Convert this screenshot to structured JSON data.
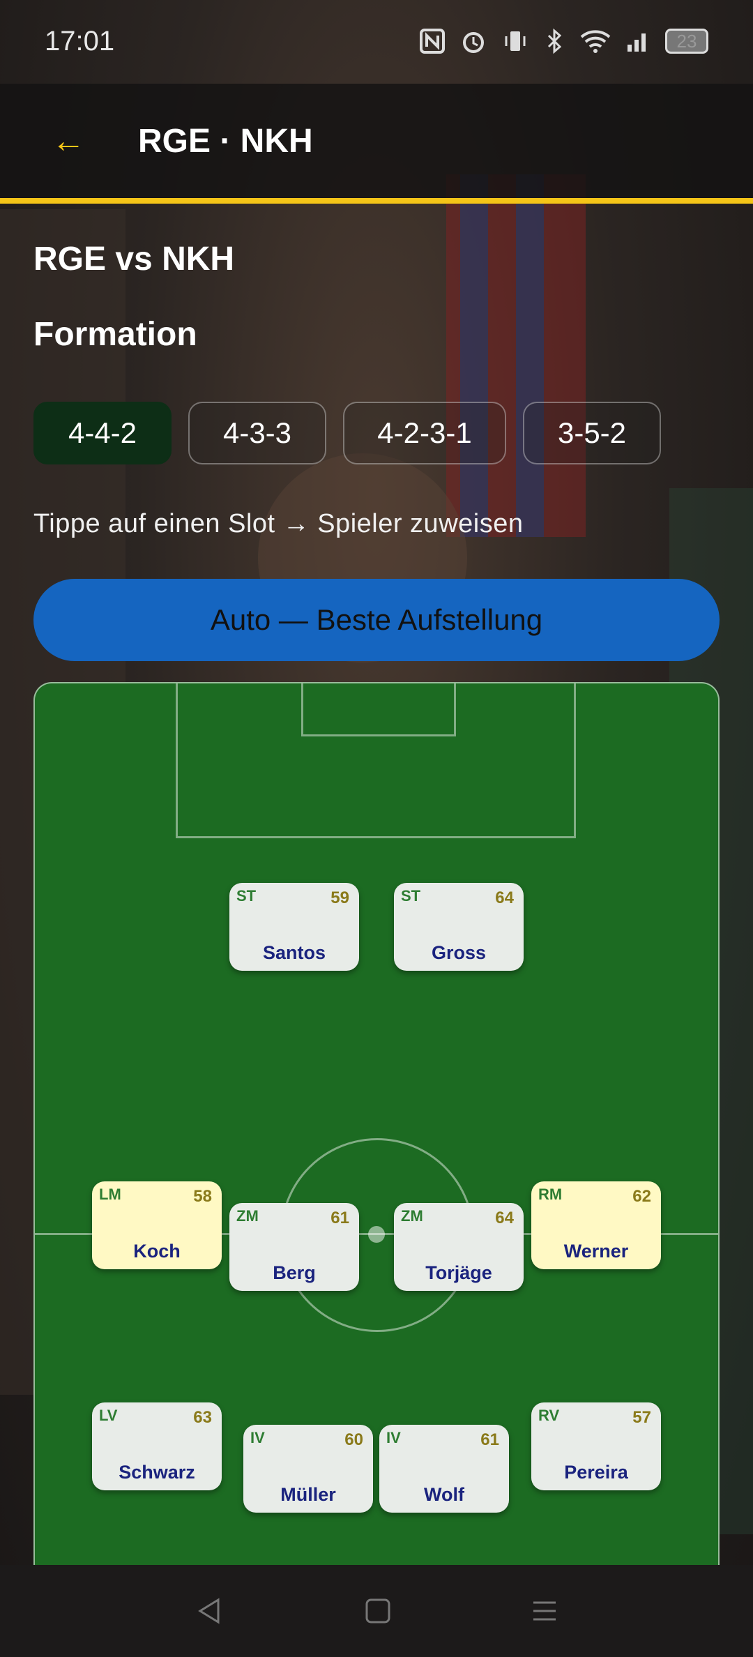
{
  "status": {
    "time": "17:01",
    "battery": "23"
  },
  "appbar": {
    "back_icon": "←",
    "title": "RGE · NKH"
  },
  "match": {
    "title": "RGE vs NKH"
  },
  "formation_section": {
    "title": "Formation"
  },
  "formations": [
    {
      "label": "4-4-2",
      "selected": true
    },
    {
      "label": "4-3-3",
      "selected": false
    },
    {
      "label": "4-2-3-1",
      "selected": false
    },
    {
      "label": "3-5-2",
      "selected": false
    }
  ],
  "hint": "Tippe auf einen Slot → Spieler zuweisen",
  "auto_button": "Auto — Beste Aufstellung",
  "lineup": [
    {
      "pos": "ST",
      "name": "Santos",
      "rating": "59"
    },
    {
      "pos": "ST",
      "name": "Gross",
      "rating": "64"
    },
    {
      "pos": "LM",
      "name": "Koch",
      "rating": "58"
    },
    {
      "pos": "ZM",
      "name": "Berg",
      "rating": "61"
    },
    {
      "pos": "ZM",
      "name": "Torjäge",
      "rating": "64"
    },
    {
      "pos": "RM",
      "name": "Werner",
      "rating": "62"
    },
    {
      "pos": "LV",
      "name": "Schwarz",
      "rating": "63"
    },
    {
      "pos": "IV",
      "name": "Müller",
      "rating": "60"
    },
    {
      "pos": "IV",
      "name": "Wolf",
      "rating": "61"
    },
    {
      "pos": "RV",
      "name": "Pereira",
      "rating": "57"
    }
  ],
  "colors": {
    "accent": "#f5c518",
    "button": "#1565c0",
    "pitch": "#1c6b22",
    "selected_chip": "#0d2e16"
  },
  "nav": {
    "back": "back-icon",
    "home": "home-icon",
    "recents": "menu-icon"
  }
}
